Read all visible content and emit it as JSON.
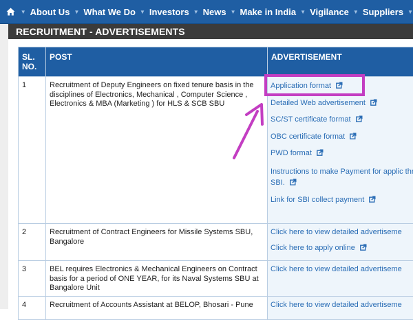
{
  "nav": {
    "home_icon": "home-icon",
    "items": [
      "About Us",
      "What We Do",
      "Investors",
      "News",
      "Make in India",
      "Vigilance",
      "Suppliers"
    ]
  },
  "page": {
    "section_title": "RECRUITMENT - ADVERTISEMENTS"
  },
  "table": {
    "headers": {
      "sl": "SL. NO.",
      "post": "POST",
      "advertisement": "ADVERTISEMENT"
    },
    "rows": [
      {
        "sl": "1",
        "post": "Recruitment of Deputy Engineers on fixed tenure basis in the disciplines of Electronics, Mechanical , Computer Science , Electronics & MBA (Marketing ) for HLS & SCB SBU",
        "links": [
          "Application format",
          "Detailed Web advertisement",
          "SC/ST certificate format",
          "OBC certificate format",
          "PWD format",
          "Instructions to make Payment for applic thro SBI.",
          "Link for SBI collect payment"
        ]
      },
      {
        "sl": "2",
        "post": "Recruitment of Contract Engineers for Missile Systems SBU, Bangalore",
        "links": [
          "Click here to view detailed advertiseme",
          "Click here to apply online"
        ]
      },
      {
        "sl": "3",
        "post": "BEL requires Electronics & Mechanical Engineers on Contract basis for a period of ONE YEAR, for its Naval Systems SBU at Bangalore Unit",
        "links": [
          "Click here to view detailed advertiseme"
        ]
      },
      {
        "sl": "4",
        "post": "Recruitment of Accounts Assistant at BELOP, Bhosari - Pune",
        "links": [
          "Click here to view detailed advertiseme"
        ]
      }
    ]
  },
  "annotation": {
    "highlight_color": "#c33ec2",
    "arrow_color": "#c33ec2"
  },
  "icons": {
    "external_link": "external-link-icon"
  }
}
